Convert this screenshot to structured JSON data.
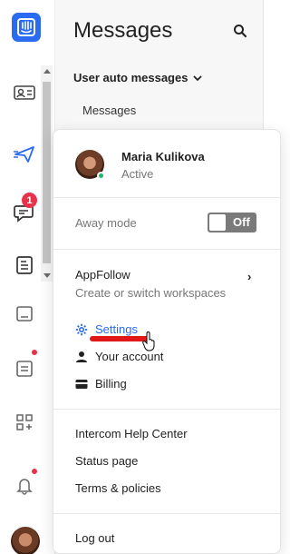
{
  "rail": {
    "icons": [
      "contacts-icon",
      "outbound-icon",
      "inbox-icon",
      "articles-icon",
      "conversations-icon",
      "reports-icon",
      "apps-icon",
      "notifications-icon"
    ],
    "inbox_badge": "1"
  },
  "panel": {
    "title": "Messages",
    "section": "User auto messages",
    "item": "Messages"
  },
  "menu": {
    "user": {
      "name": "Maria Kulikova",
      "status": "Active"
    },
    "away_label": "Away mode",
    "away_toggle": "Off",
    "workspace": {
      "name": "AppFollow",
      "desc": "Create or switch workspaces"
    },
    "settings": "Settings",
    "account": "Your account",
    "billing": "Billing",
    "help_center": "Intercom Help Center",
    "status_page": "Status page",
    "terms": "Terms & policies",
    "logout": "Log out"
  },
  "colors": {
    "accent": "#2b6bf2",
    "badge": "#e8324a",
    "online": "#1fb865",
    "annotation": "#e01818"
  }
}
